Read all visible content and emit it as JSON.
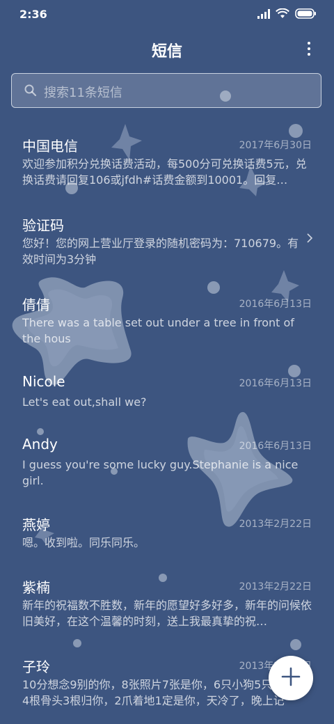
{
  "status": {
    "time": "2:36"
  },
  "header": {
    "title": "短信"
  },
  "search": {
    "placeholder": "搜索11条短信"
  },
  "messages": [
    {
      "name": "中国电信",
      "date": "2017年6月30日",
      "preview": "欢迎参加积分兑换话费活动，每500分可兑换话费5元，兑换话费请回复106或jfdh#话费金额到10001。回复…"
    },
    {
      "name": "验证码",
      "date": "",
      "preview": "您好！您的网上营业厅登录的随机密码为：710679。有效时间为3分钟"
    },
    {
      "name": "倩倩",
      "date": "2016年6月13日",
      "preview": "There was a table set out under a tree in front of the hous"
    },
    {
      "name": "Nicole",
      "date": "2016年6月13日",
      "preview": "Let's eat out,shall we?"
    },
    {
      "name": "Andy",
      "date": "2016年6月13日",
      "preview": "I guess you're some lucky guy.Stephanie is a nice girl."
    },
    {
      "name": "燕婷",
      "date": "2013年2月22日",
      "preview": "嗯。收到啦。同乐同乐。"
    },
    {
      "name": "紫楠",
      "date": "2013年2月22日",
      "preview": "新年的祝福数不胜数，新年的愿望好多好多，新年的问候依旧美好，在这个温馨的时刻，送上我最真挚的祝…"
    },
    {
      "name": "子玲",
      "date": "2013年2月22日",
      "preview": "10分想念9别的你，8张照片7张是你，6只小狗5只像你，4根骨头3根归你，2爪着地1定是你，天冷了，晚上记"
    }
  ],
  "icons": {
    "signal": "signal-icon",
    "wifi": "wifi-icon",
    "battery": "battery-icon",
    "more": "more-vertical-icon",
    "search": "search-icon",
    "chevron": "chevron-right-icon",
    "compose": "plus-icon"
  },
  "colors": {
    "background": "#3d5580",
    "text": "#ffffff",
    "fab": "#ffffff",
    "fab_icon": "#3d5580"
  }
}
